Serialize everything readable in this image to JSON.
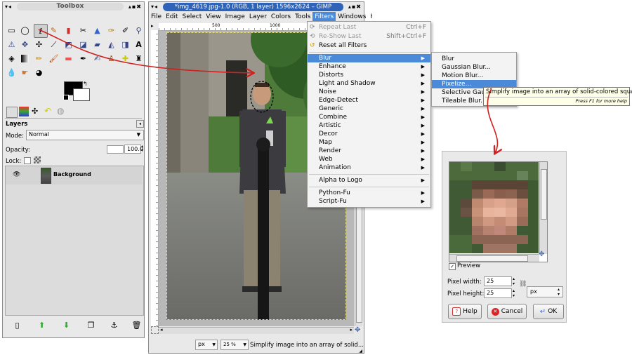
{
  "toolbox": {
    "title": "Toolbox",
    "tab_icons": [
      "brushes-icon",
      "patterns-icon",
      "gradients-icon",
      "fonts-icon",
      "undo-icon"
    ],
    "layers_label": "Layers",
    "mode_label": "Mode:",
    "mode_value": "Normal",
    "opacity_label": "Opacity:",
    "opacity_value": "100.0",
    "lock_label": "Lock:",
    "layer_name": "Background"
  },
  "image_window": {
    "title": "*img_4619.jpg-1.0 (RGB, 1 layer) 1596x2624 – GIMP",
    "menu": [
      "File",
      "Edit",
      "Select",
      "View",
      "Image",
      "Layer",
      "Colors",
      "Tools",
      "Filters",
      "Windows",
      "Help"
    ],
    "ruler_marks": [
      "500",
      "1000"
    ],
    "unit": "px",
    "zoom": "25 %",
    "status": "Simplify image into an array of solid..."
  },
  "filters_menu": {
    "top_items": [
      {
        "label": "Repeat Last",
        "shortcut": "Ctrl+F"
      },
      {
        "label": "Re-Show Last",
        "shortcut": "Shift+Ctrl+F"
      },
      {
        "label": "Reset all Filters",
        "shortcut": ""
      }
    ],
    "groups": [
      "Blur",
      "Enhance",
      "Distorts",
      "Light and Shadow",
      "Noise",
      "Edge-Detect",
      "Generic",
      "Combine",
      "Artistic",
      "Decor",
      "Map",
      "Render",
      "Web",
      "Animation"
    ],
    "bottom_items": [
      "Alpha to Logo",
      "Python-Fu",
      "Script-Fu"
    ]
  },
  "blur_menu": {
    "items": [
      "Blur",
      "Gaussian Blur...",
      "Motion Blur...",
      "Pixelize...",
      "Selective Gaussian Blur...",
      "Tileable Blur..."
    ],
    "selected_index": 3
  },
  "tooltip": {
    "text": "Simplify image into an array of solid-colored squares",
    "help": "Press F1 for more help"
  },
  "pixelize_dialog": {
    "preview_label": "Preview",
    "pixel_width_label": "Pixel width:",
    "pixel_width": "25",
    "pixel_height_label": "Pixel height:",
    "pixel_height": "25",
    "unit": "px",
    "help_label": "Help",
    "cancel_label": "Cancel",
    "ok_label": "OK"
  },
  "colors": {
    "accent": "#4a8ad8",
    "title_bar": "#2f63b8",
    "arrow": "#d02020"
  }
}
